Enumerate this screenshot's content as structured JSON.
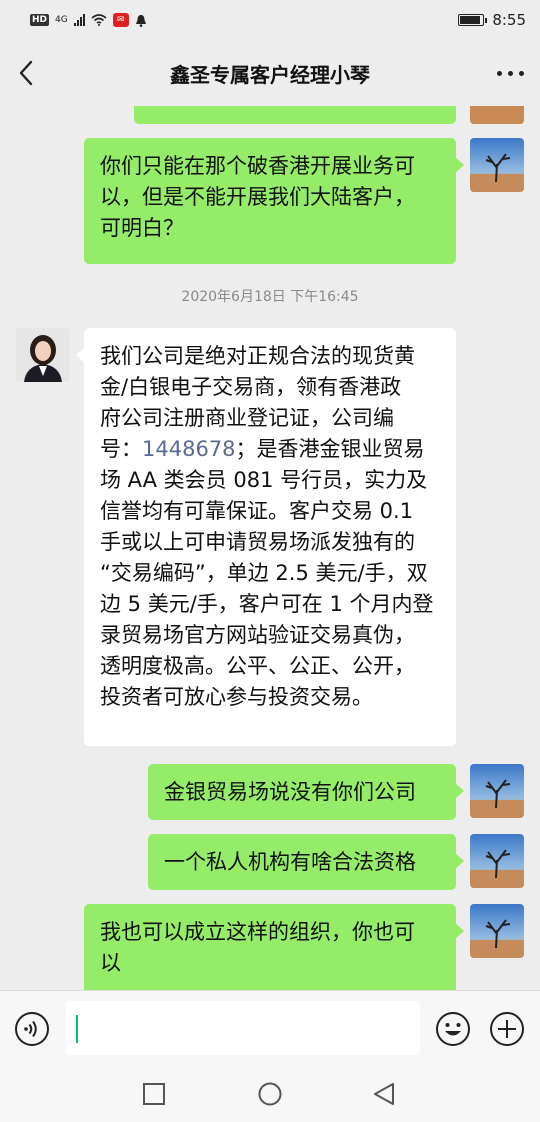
{
  "status_bar": {
    "hd_badge": "HD",
    "network": "4G",
    "time": "8:55",
    "battery_level": 0.9
  },
  "header": {
    "back_icon": "chevron-left-icon",
    "title": "鑫圣专属客户经理小琴",
    "more_icon": "more-dots-icon"
  },
  "messages": [
    {
      "sender": "me",
      "lines": [
        "你们只能在那个破香港开展业务可",
        "以，但是不能开展我们大陆客户，",
        "可明白？"
      ]
    },
    {
      "timestamp": "2020年6月18日 下午16:45"
    },
    {
      "sender": "them",
      "lines": [
        "我们公司是绝对正规合法的现货黄",
        "金/白银电子交易商，领有香港政",
        "府公司注册商业登记证，公司编",
        "号：",
        "场 AA 类会员 081 号行员，实力及",
        "信誉均有可靠保证。客户交易 0.1",
        "手或以上可申请贸易场派发独有的",
        "“交易编码”，单边 2.5 美元/手，双",
        "边 5 美元/手，客户可在 1 个月内登",
        "录贸易场官方网站验证交易真伪，",
        "透明度极高。公平、公正、公开，",
        "投资者可放心参与投资交易。"
      ],
      "link_number": "1448678",
      "line4_suffix": "；是香港金银业贸易"
    },
    {
      "sender": "me",
      "lines": [
        "金银贸易场说没有你们公司"
      ]
    },
    {
      "sender": "me",
      "lines": [
        "一个私人机构有啥合法资格"
      ]
    },
    {
      "sender": "me",
      "lines": [
        "我也可以成立这样的组织，你也可",
        "以"
      ]
    }
  ],
  "input_bar": {
    "voice_icon": "voice-icon",
    "text_value": "",
    "emoji_icon": "emoji-icon",
    "plus_icon": "plus-circle-icon"
  },
  "nav_bar": {
    "recents_icon": "square-icon",
    "home_icon": "circle-icon",
    "back_icon": "triangle-back-icon"
  },
  "colors": {
    "my_bubble": "#95ec69",
    "their_bubble": "#ffffff",
    "background": "#ededed",
    "link": "#576b95",
    "caret": "#07c160"
  }
}
